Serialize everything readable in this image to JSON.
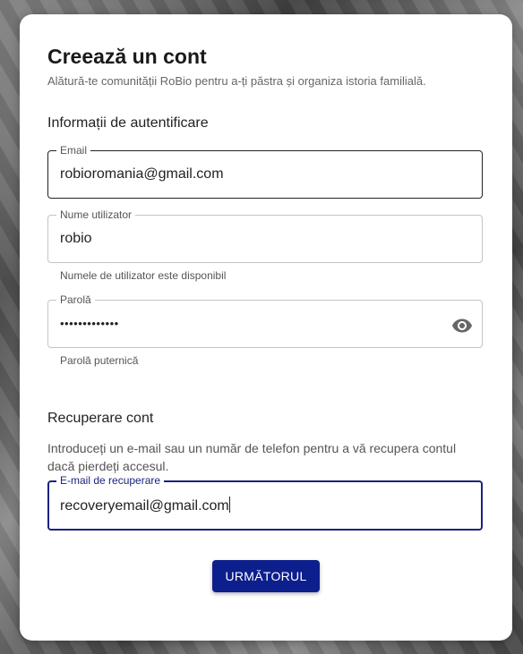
{
  "header": {
    "title": "Creează un cont",
    "subtitle": "Alătură-te comunității RoBio pentru a-ți păstra și organiza istoria familială."
  },
  "auth_section": {
    "title": "Informații de autentificare",
    "email": {
      "label": "Email",
      "value": "robioromania@gmail.com"
    },
    "username": {
      "label": "Nume utilizator",
      "value": "robio",
      "helper": "Numele de utilizator este disponibil"
    },
    "password": {
      "label": "Parolă",
      "value": "•••••••••••••",
      "helper": "Parolă puternică",
      "toggle_icon": "eye-icon"
    }
  },
  "recovery_section": {
    "title": "Recuperare cont",
    "description": "Introduceți un e-mail sau un număr de telefon pentru a vă recupera contul dacă pierdeți accesul.",
    "recovery_email": {
      "label": "E-mail de recuperare",
      "value": "recoveryemail@gmail.com"
    }
  },
  "actions": {
    "next_label": "URMĂTORUL"
  },
  "colors": {
    "primary": "#0d1f8c",
    "focus_border": "#1a237e"
  }
}
